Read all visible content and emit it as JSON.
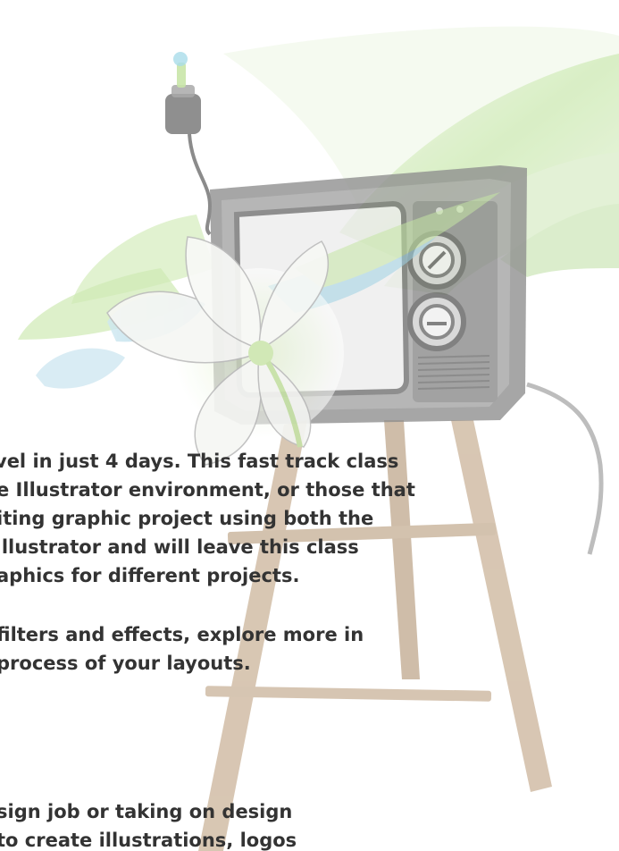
{
  "paragraph_1": {
    "lines": [
      "vel in just 4 days. This fast track class",
      "e Illustrator environment, or those that",
      "iting graphic project using both the",
      " Illustrator and will leave this class",
      "aphics for different projects."
    ]
  },
  "paragraph_2": {
    "lines": [
      "filters and effects, explore more in",
      "process of your layouts."
    ]
  },
  "paragraph_3": {
    "lines": [
      "sign job or taking on design",
      "to create illustrations, logos"
    ]
  },
  "illustration": {
    "subject": "retro television on wooden easel with flower and green swirls",
    "colors": {
      "tv_body": "#8c8c8c",
      "easel_wood": "#c9b49a",
      "swirl_green": "#bfe3a0",
      "swirl_blue": "#a8d4e6",
      "flower": "#f4f6f2"
    }
  }
}
